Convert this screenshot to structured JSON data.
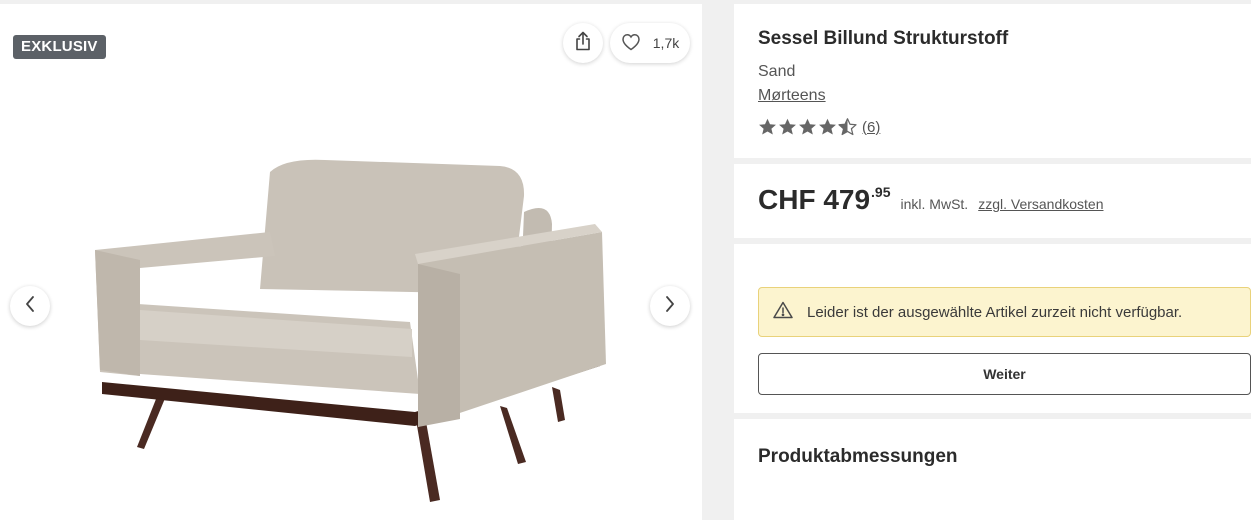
{
  "gallery": {
    "badge": "EXKLUSIV",
    "like_count": "1,7k",
    "icons": {
      "share": "share-icon",
      "like": "heart-icon",
      "prev": "chevron-left-icon",
      "next": "chevron-right-icon"
    }
  },
  "product": {
    "title": "Sessel Billund Strukturstoff",
    "variant": "Sand",
    "brand": "Mørteens",
    "rating": 4.5,
    "review_count": "(6)"
  },
  "price": {
    "currency_amount": "CHF 479",
    "cents": ".95",
    "tax_note": "inkl. MwSt.",
    "shipping_link": "zzgl. Versandkosten"
  },
  "availability": {
    "alert_text": "Leider ist der ausgewählte Artikel zurzeit nicht verfügbar.",
    "alert_icon": "warning-icon",
    "continue_label": "Weiter"
  },
  "dimensions": {
    "section_title": "Produktabmessungen"
  },
  "colors": {
    "badge_bg": "#5c6167",
    "star": "#666666",
    "alert_bg": "#fcf4cf",
    "alert_border": "#e9d27a"
  }
}
